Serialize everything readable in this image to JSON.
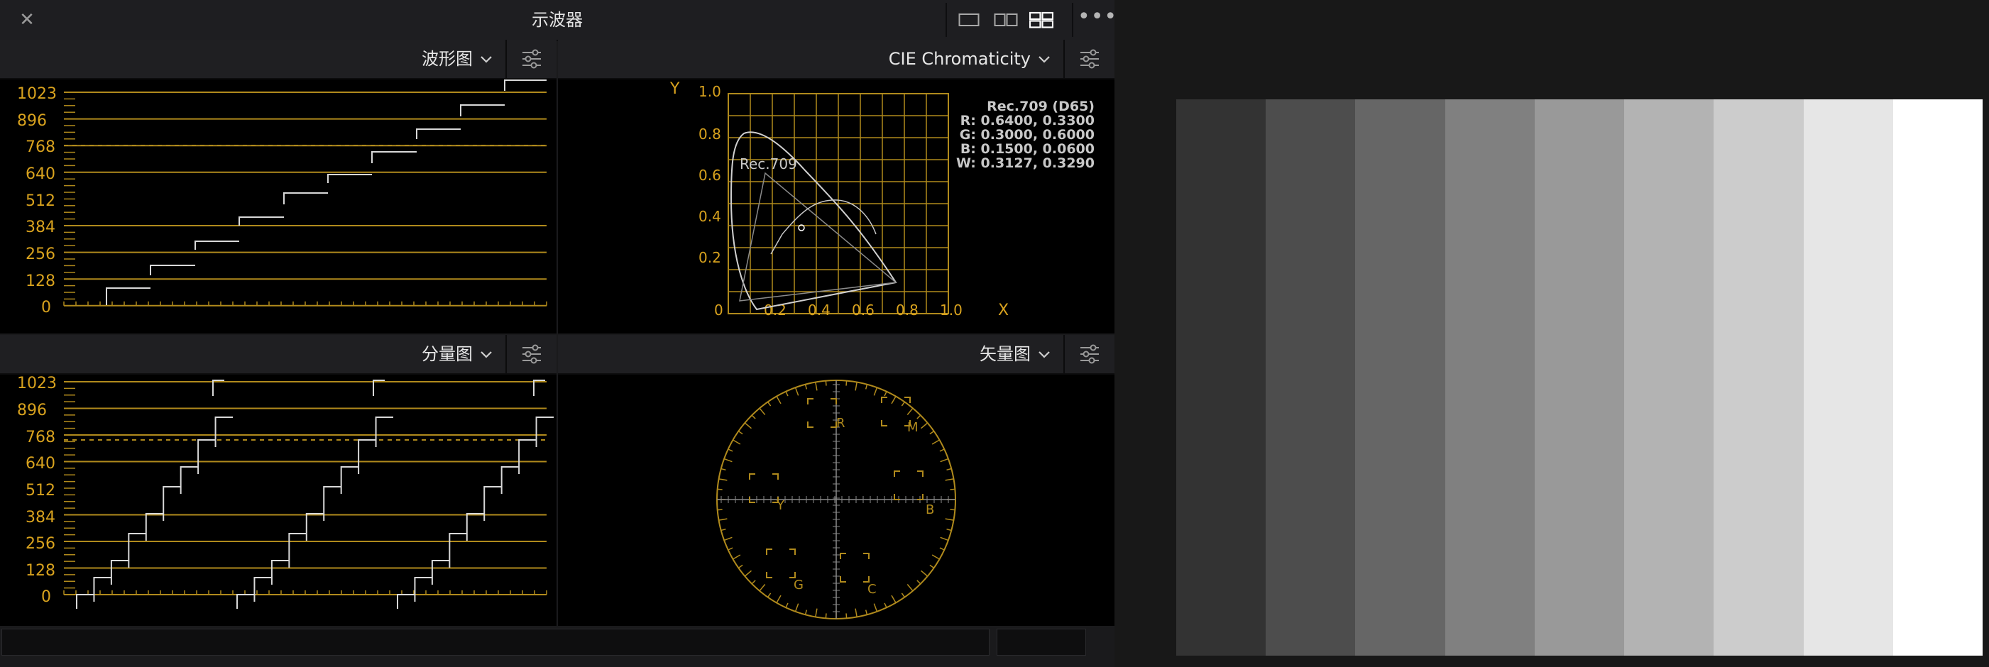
{
  "window": {
    "title": "示波器"
  },
  "icons": {
    "close": "close-icon",
    "layout_single": "layout-single-icon",
    "layout_double": "layout-double-icon",
    "layout_quad": "layout-quad-icon",
    "more": "more-icon",
    "settings": "settings-sliders-icon",
    "chevron": "chevron-down-icon"
  },
  "panels": {
    "waveform": {
      "label": "波形图",
      "ticks": [
        "1023",
        "896",
        "768",
        "640",
        "512",
        "384",
        "256",
        "128",
        "0"
      ]
    },
    "cie": {
      "label": "CIE Chromaticity",
      "y_axis_label": "Y",
      "x_axis_label": "X",
      "y_ticks": [
        "1.0",
        "0.8",
        "0.6",
        "0.4",
        "0.2"
      ],
      "x_ticks": [
        "0",
        "0.2",
        "0.4",
        "0.6",
        "0.8",
        "1.0"
      ],
      "gamut_label": "Rec.709",
      "info": [
        "Rec.709 (D65)",
        "R: 0.6400, 0.3300",
        "G: 0.3000, 0.6000",
        "B: 0.1500, 0.0600",
        "W: 0.3127, 0.3290"
      ]
    },
    "parade": {
      "label": "分量图",
      "ticks": [
        "1023",
        "896",
        "768",
        "640",
        "512",
        "384",
        "256",
        "128",
        "0"
      ]
    },
    "vectorscope": {
      "label": "矢量图",
      "targets": [
        "R",
        "M",
        "B",
        "C",
        "G",
        "Y"
      ]
    }
  },
  "colors": {
    "graticule": "#b08a1c",
    "accent_text": "#d8a21e",
    "trace": "#d8d8d8",
    "panel_bg": "#000000",
    "header_bg": "#1f1f22"
  },
  "preview": {
    "gray_bars": [
      "#333333",
      "#4d4d4d",
      "#666666",
      "#808080",
      "#999999",
      "#b3b3b3",
      "#cccccc",
      "#e6e6e6",
      "#ffffff"
    ]
  }
}
